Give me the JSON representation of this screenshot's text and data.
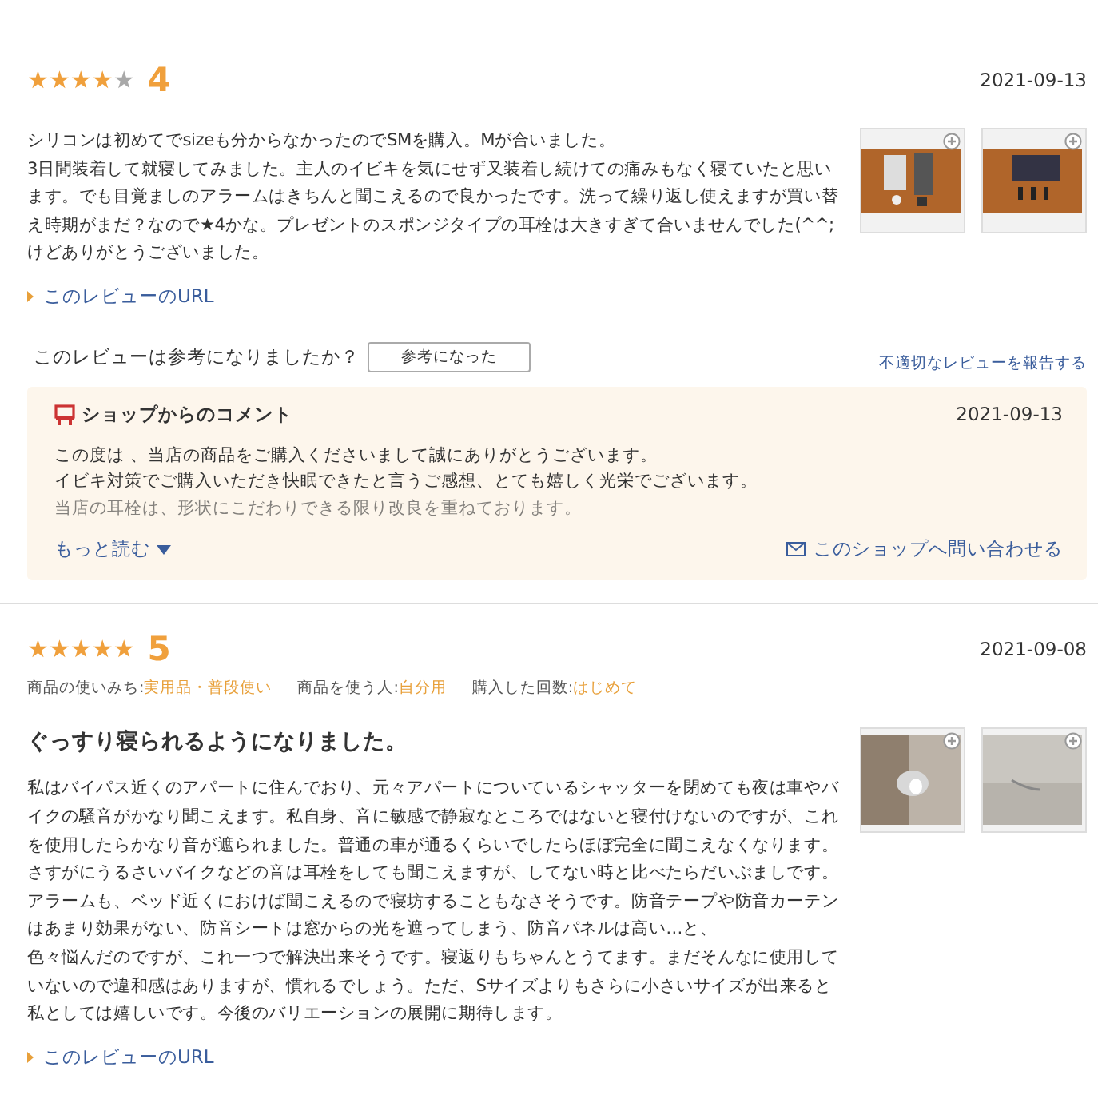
{
  "reviews": [
    {
      "stars": 4,
      "score": "4",
      "date": "2021-09-13",
      "paragraphs": [
        "シリコンは初めてでsizeも分からなかったのでSMを購入。Mが合いました。",
        "3日間装着して就寝してみました。主人のイビキを気にせず又装着し続けての痛みもなく寝ていたと思います。でも目覚ましのアラームはきちんと聞こえるので良かったです。洗って繰り返し使えますが買い替え時期がまだ？なので★4かな。プレゼントのスポンジタイプの耳栓は大きすぎて合いませんでした(^^;けどありがとうございました。"
      ],
      "photos": [
        {
          "kind": "picture"
        },
        {
          "kind": "picture"
        }
      ],
      "url_link": "このレビューのURL",
      "helpful": {
        "question": "このレビューは参考になりましたか？",
        "button": "参考になった",
        "report": "不適切なレビューを報告する"
      },
      "shop_comment": {
        "title": "ショップからのコメント",
        "date": "2021-09-13",
        "lines": [
          "この度は 、当店の商品をご購入くださいまして誠にありがとうございます。",
          "イビキ対策でご購入いただき快眠できたと言うご感想、とても嬉しく光栄でございます。",
          "当店の耳栓は、形状にこだわりできる限り改良を重ねております。"
        ],
        "more": "もっと読む",
        "contact": "このショップへ問い合わせる"
      }
    },
    {
      "stars": 5,
      "score": "5",
      "date": "2021-09-08",
      "attributes": [
        {
          "label": "商品の使いみち:",
          "value": "実用品・普段使い"
        },
        {
          "label": "商品を使う人:",
          "value": "自分用"
        },
        {
          "label": "購入した回数:",
          "value": "はじめて"
        }
      ],
      "title": "ぐっすり寝られるようになりました。",
      "paragraphs": [
        "私はバイパス近くのアパートに住んでおり、元々アパートについているシャッターを閉めても夜は車やバイクの騒音がかなり聞こえます。私自身、音に敏感で静寂なところではないと寝付けないのですが、これを使用したらかなり音が遮られました。普通の車が通るくらいでしたらほぼ完全に聞こえなくなります。さすがにうるさいバイクなどの音は耳栓をしても聞こえますが、してない時と比べたらだいぶましです。アラームも、ベッド近くにおけば聞こえるので寝坊することもなさそうです。防音テープや防音カーテンはあまり効果がない、防音シートは窓からの光を遮ってしまう、防音パネルは高い…と、",
        "色々悩んだのですが、これ一つで解決出来そうです。寝返りもちゃんとうてます。まだそんなに使用していないので違和感はありますが、慣れるでしょう。ただ、Sサイズよりもさらに小さいサイズが出来ると私としては嬉しいです。今後のバリエーションの展開に期待します。"
      ],
      "photos": [
        {
          "kind": "picture"
        },
        {
          "kind": "picture"
        }
      ],
      "url_link": "このレビューのURL"
    }
  ]
}
